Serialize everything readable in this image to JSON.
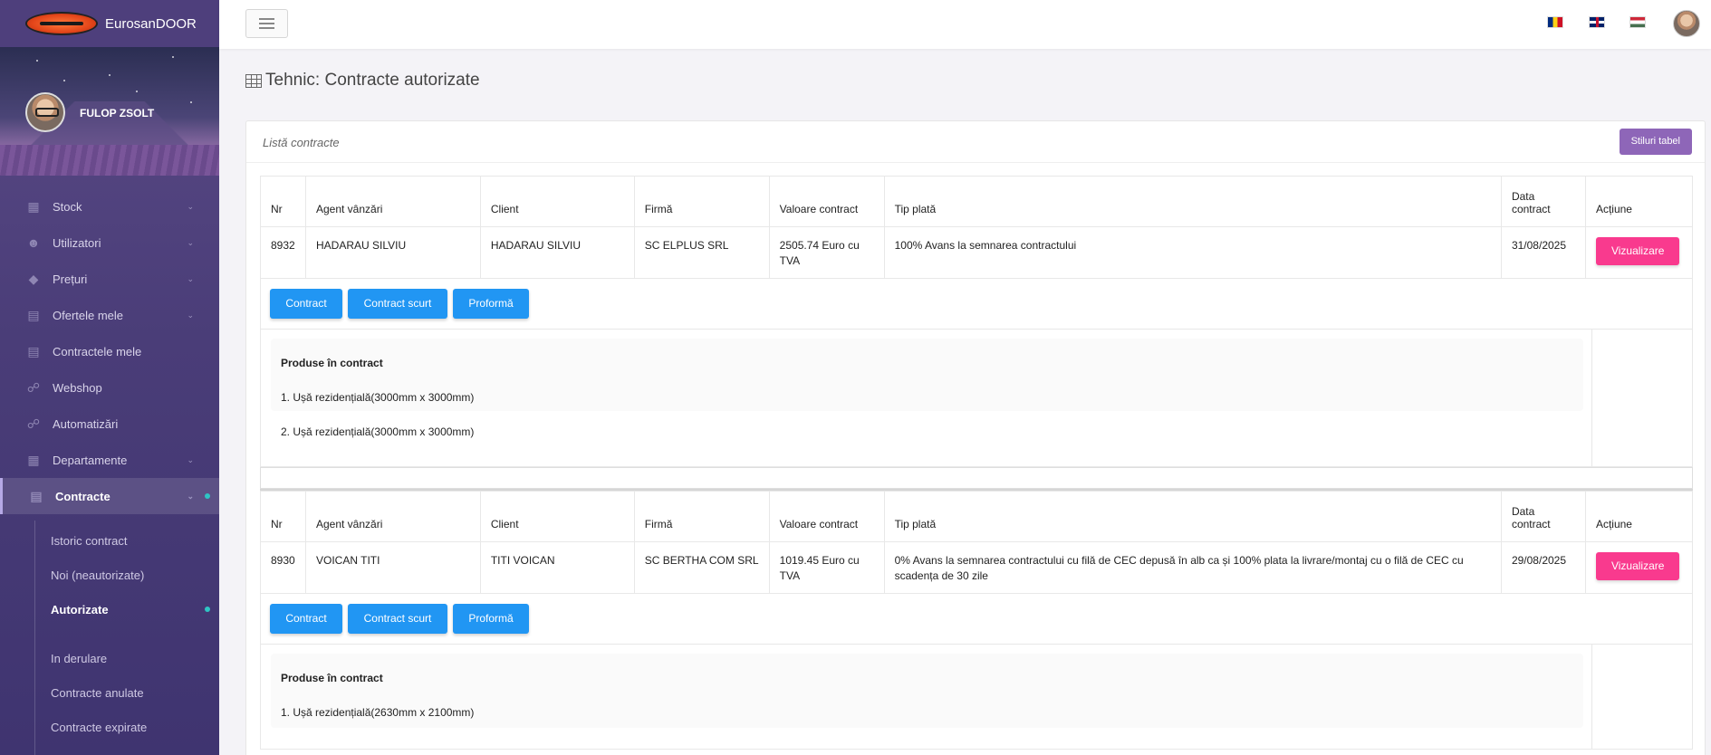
{
  "app": {
    "name": "EurosanDOOR"
  },
  "user": {
    "name": "FULOP ZSOLT"
  },
  "sidebar": {
    "items": [
      {
        "label": "Stock",
        "icon": "warehouse-icon",
        "chevron": true
      },
      {
        "label": "Utilizatori",
        "icon": "users-icon",
        "chevron": true
      },
      {
        "label": "Prețuri",
        "icon": "tag-icon",
        "chevron": true
      },
      {
        "label": "Ofertele mele",
        "icon": "file-icon",
        "chevron": true
      },
      {
        "label": "Contractele mele",
        "icon": "file-icon",
        "chevron": false
      },
      {
        "label": "Webshop",
        "icon": "cart-icon",
        "chevron": false
      },
      {
        "label": "Automatizări",
        "icon": "cart-icon",
        "chevron": false
      },
      {
        "label": "Departamente",
        "icon": "department-icon",
        "chevron": true
      },
      {
        "label": "Contracte",
        "icon": "file-icon",
        "chevron": true,
        "active": true
      }
    ],
    "sub_items": [
      {
        "label": "Istoric contract"
      },
      {
        "label": "Noi (neautorizate)"
      },
      {
        "label": "Autorizate",
        "active": true
      },
      {
        "label": "In derulare"
      },
      {
        "label": "Contracte anulate"
      },
      {
        "label": "Contracte expirate"
      }
    ]
  },
  "page": {
    "title": "Tehnic: Contracte autorizate"
  },
  "card": {
    "title": "Listă contracte",
    "style_button": "Stiluri tabel"
  },
  "table": {
    "headers": [
      "Nr",
      "Agent vânzări",
      "Client",
      "Firmă",
      "Valoare contract",
      "Tip plată",
      "Data contract",
      "Acțiune"
    ],
    "action_label": "Vizualizare",
    "buttons": [
      "Contract",
      "Contract scurt",
      "Proformă"
    ],
    "products_title": "Produse în contract"
  },
  "contracts": [
    {
      "nr": "8932",
      "agent": "HADARAU SILVIU",
      "client": "HADARAU SILVIU",
      "firma": "SC ELPLUS SRL",
      "valoare": "2505.74 Euro cu TVA",
      "tip_plata": "100% Avans la semnarea contractului",
      "data": "31/08/2025",
      "products": [
        "1. Ușă rezidențială(3000mm x 3000mm)",
        "2. Ușă rezidențială(3000mm x 3000mm)"
      ]
    },
    {
      "nr": "8930",
      "agent": "VOICAN TITI",
      "client": "TITI VOICAN",
      "firma": "SC BERTHA COM SRL",
      "valoare": "1019.45 Euro cu TVA",
      "tip_plata": "0% Avans la semnarea contractului cu filă de CEC depusă în alb ca și 100% plata la livrare/montaj cu o filă de CEC cu scadența de 30 zile",
      "data": "29/08/2025",
      "products": [
        "1. Ușă rezidențială(2630mm x 2100mm)"
      ]
    }
  ]
}
